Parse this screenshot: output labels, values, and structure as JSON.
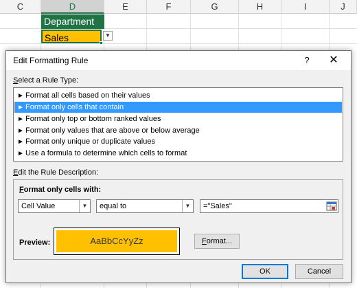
{
  "sheet": {
    "columns": [
      "C",
      "D",
      "E",
      "F",
      "G",
      "H",
      "I",
      "J"
    ],
    "selected_column": "D",
    "header_cell": "Department",
    "value_cell": "Sales",
    "colors": {
      "header_fill": "#217346",
      "value_fill": "#ffc000"
    },
    "dropdown_icon": "chevron-down-icon"
  },
  "dialog": {
    "title": "Edit Formatting Rule",
    "help_glyph": "?",
    "close_glyph": "✕",
    "select_rule_type_label": "Select a Rule Type:",
    "rule_types": [
      "Format all cells based on their values",
      "Format only cells that contain",
      "Format only top or bottom ranked values",
      "Format only values that are above or below average",
      "Format only unique or duplicate values",
      "Use a formula to determine which cells to format"
    ],
    "selected_rule_index": 1,
    "edit_description_label": "Edit the Rule Description:",
    "format_only_cells_with_label": "Format only cells with:",
    "condition": {
      "field": "Cell Value",
      "operator": "equal to",
      "value": "=\"Sales\""
    },
    "preview_label": "Preview:",
    "preview_text": "AaBbCcYyZz",
    "preview_fill": "#ffc000",
    "format_button": "Format...",
    "ok_button": "OK",
    "cancel_button": "Cancel",
    "selection_color": "#3399ff"
  }
}
